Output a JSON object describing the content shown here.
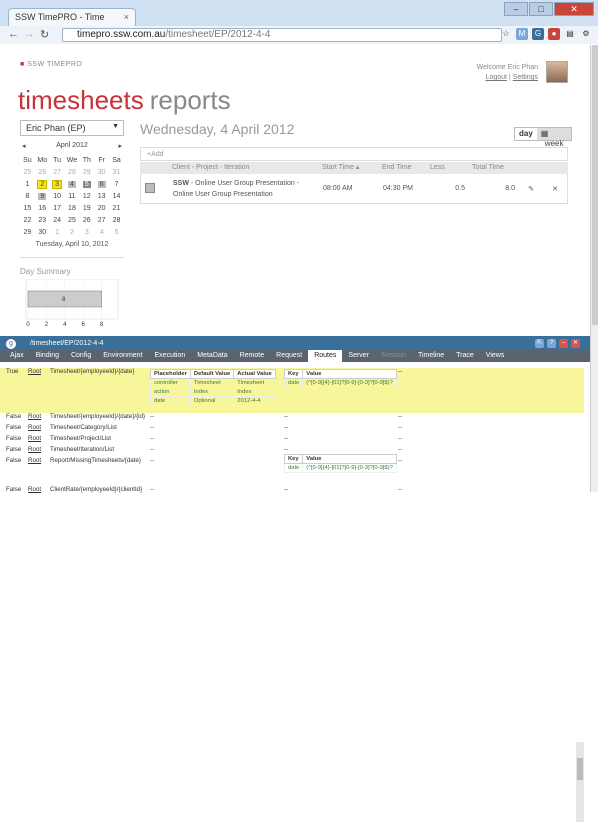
{
  "browser": {
    "tab_title": "SSW TimePRO - Time",
    "tab_close": "×",
    "url_host": "timepro.ssw.com.au",
    "url_path": "/timesheet/EP/2012-4-4"
  },
  "app": {
    "logo": "SSW TIMEPRO",
    "welcome": "Welcome Eric Phan",
    "logout": "Logout",
    "settings": "Settings",
    "sep": "|",
    "nav_timesheets": "timesheets",
    "nav_reports": "reports"
  },
  "sidebar": {
    "user": "Eric Phan (EP)",
    "calendar": {
      "month": "April 2012",
      "prev": "◂",
      "next": "▸",
      "weekdays": [
        "Su",
        "Mo",
        "Tu",
        "We",
        "Th",
        "Fr",
        "Sa"
      ],
      "weeks": [
        [
          "25",
          "26",
          "27",
          "28",
          "29",
          "30",
          "31"
        ],
        [
          "1",
          "2",
          "3",
          "4",
          "5",
          "6",
          "7"
        ],
        [
          "8",
          "9",
          "10",
          "11",
          "12",
          "13",
          "14"
        ],
        [
          "15",
          "16",
          "17",
          "18",
          "19",
          "20",
          "21"
        ],
        [
          "22",
          "23",
          "24",
          "25",
          "26",
          "27",
          "28"
        ],
        [
          "29",
          "30",
          "1",
          "2",
          "3",
          "4",
          "5"
        ]
      ],
      "footer": "Tuesday, April 10, 2012"
    },
    "day_summary": "Day Summary",
    "day_summary_chart": {
      "type": "bar",
      "values": [
        8
      ],
      "x_ticks": [
        "0",
        "2",
        "4",
        "6",
        "8"
      ],
      "bar_label": "8",
      "xlim": [
        0,
        10
      ]
    }
  },
  "main": {
    "date_title": "Wednesday, 4 April 2012",
    "day_btn": "day",
    "week_btn": "week",
    "add": "+Add",
    "columns": [
      "Client - Project - Iteration",
      "Start Time",
      "End Time",
      "Less",
      "Total Time"
    ],
    "row": {
      "client": "SSW",
      "project_text": "- Online User Group Presentation -",
      "iteration": "Online User Group Presentation",
      "start": "08:00 AM",
      "end": "04:30 PM",
      "less": "0.5",
      "total": "8.0"
    }
  },
  "glimpse": {
    "title": "/timesheet/EP/2012-4-4",
    "tabs": [
      "Ajax",
      "Binding",
      "Config",
      "Environment",
      "Execution",
      "MetaData",
      "Remote",
      "Request",
      "Routes",
      "Server",
      "Session",
      "Timeline",
      "Trace",
      "Views"
    ],
    "active_tab": "Routes",
    "rows": [
      {
        "match": "True",
        "area": "Root",
        "url": "Timesheet/{employeeId}/{date}"
      },
      {
        "match": "False",
        "area": "Root",
        "url": "Timesheet/{employeeId}/{date}/{id}",
        "d1": "--",
        "d2": "--",
        "d3": "--"
      },
      {
        "match": "False",
        "area": "Root",
        "url": "Timesheet/Category/List",
        "d1": "--",
        "d2": "--",
        "d3": "--"
      },
      {
        "match": "False",
        "area": "Root",
        "url": "Timesheet/Project/List",
        "d1": "--",
        "d2": "--",
        "d3": "--"
      },
      {
        "match": "False",
        "area": "Root",
        "url": "Timesheet/Iteration/List",
        "d1": "--",
        "d2": "--",
        "d3": "--"
      },
      {
        "match": "False",
        "area": "Root",
        "url": "Report/MissingTimesheets/{date}",
        "d1": "--",
        "d3": "--"
      },
      {
        "match": "False",
        "area": "Root",
        "url": "ClientRate/{employeeId}/{clientId}",
        "d1": "--",
        "d2": "--",
        "d3": "--"
      }
    ],
    "param_table": {
      "headers": [
        "Placeholder",
        "Default Value",
        "Actual Value"
      ],
      "rows": [
        [
          "controller",
          "Timesheet",
          "Timesheet"
        ],
        [
          "action",
          "Index",
          "Index"
        ],
        [
          "date",
          "Optional",
          "2012-4-4"
        ]
      ]
    },
    "constraint_table": {
      "headers": [
        "Key",
        "Value"
      ],
      "rows": [
        [
          "date",
          "(^[0-9]{4}-[01]?[0-9]-[0-3]?[0-9]$)?"
        ]
      ]
    },
    "dash": "--"
  }
}
